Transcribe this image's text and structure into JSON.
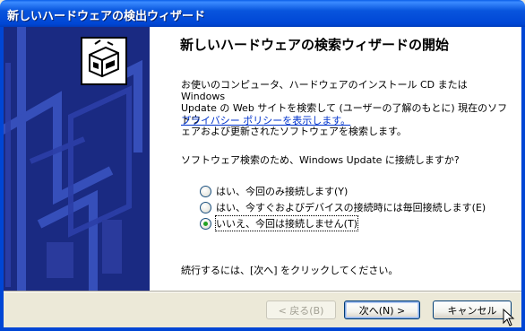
{
  "window": {
    "title": "新しいハードウェアの検出ウィザード"
  },
  "page": {
    "heading": "新しいハードウェアの検索ウィザードの開始",
    "description_lines": [
      "お使いのコンピュータ、ハードウェアのインストール CD または Windows",
      "Update の Web サイトを検索して (ユーザーの了解のもとに) 現在のソフトウ",
      "ェアおよび更新されたソフトウェアを検索します。"
    ],
    "privacy_link": "プライバシー ポリシーを表示します。",
    "question": "ソフトウェア検索のため、Windows Update に接続しますか?",
    "options": [
      {
        "label": "はい、今回のみ接続します(Y)",
        "selected": false
      },
      {
        "label": "はい、今すぐおよびデバイスの接続時には毎回接続します(E)",
        "selected": false
      },
      {
        "label": "いいえ、今回は接続しません(T)",
        "selected": true
      }
    ],
    "continue_note": "続行するには、[次へ] をクリックしてください。"
  },
  "buttons": {
    "back": "< 戻る(B)",
    "next": "次へ(N) >",
    "cancel": "キャンセル"
  },
  "colors": {
    "title_bar": "#0855dd",
    "side_panel": "#1a2a82",
    "link": "#0033cc",
    "radio_dot": "#21a121"
  }
}
